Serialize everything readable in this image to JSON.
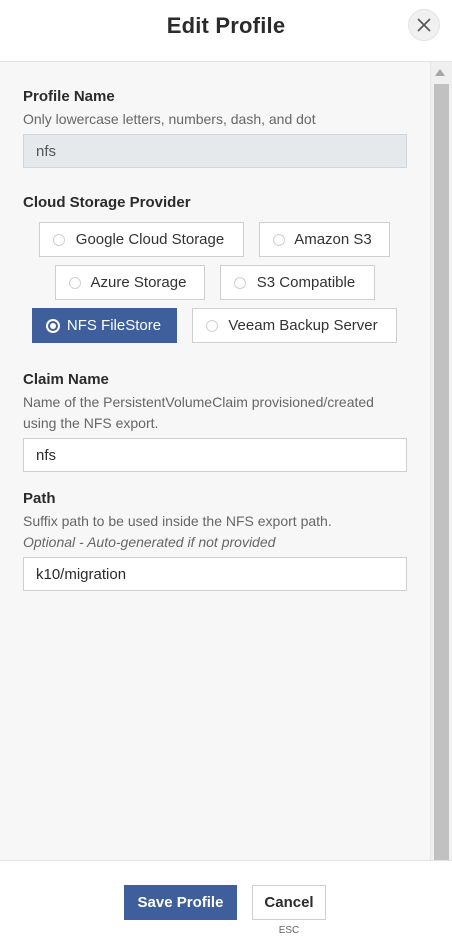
{
  "header": {
    "title": "Edit Profile",
    "close_icon": "close-icon"
  },
  "profile_name": {
    "label": "Profile Name",
    "hint": "Only lowercase letters, numbers, dash, and dot",
    "value": "nfs"
  },
  "provider": {
    "label": "Cloud Storage Provider",
    "selected": "NFS FileStore",
    "options": [
      "Google Cloud Storage",
      "Amazon S3",
      "Azure Storage",
      "S3 Compatible",
      "NFS FileStore",
      "Veeam Backup Server"
    ]
  },
  "claim_name": {
    "label": "Claim Name",
    "hint_line1": "Name of the PersistentVolumeClaim provisioned/created",
    "hint_line2": "using the NFS export.",
    "value": "nfs"
  },
  "path": {
    "label": "Path",
    "hint": "Suffix path to be used inside the NFS export path.",
    "optional_hint": "Optional - Auto-generated if not provided",
    "value": "k10/migration"
  },
  "footer": {
    "save_label": "Save Profile",
    "cancel_label": "Cancel",
    "esc_hint": "ESC"
  },
  "colors": {
    "accent": "#3e5f9b",
    "panel_bg": "#f7f7f7"
  }
}
